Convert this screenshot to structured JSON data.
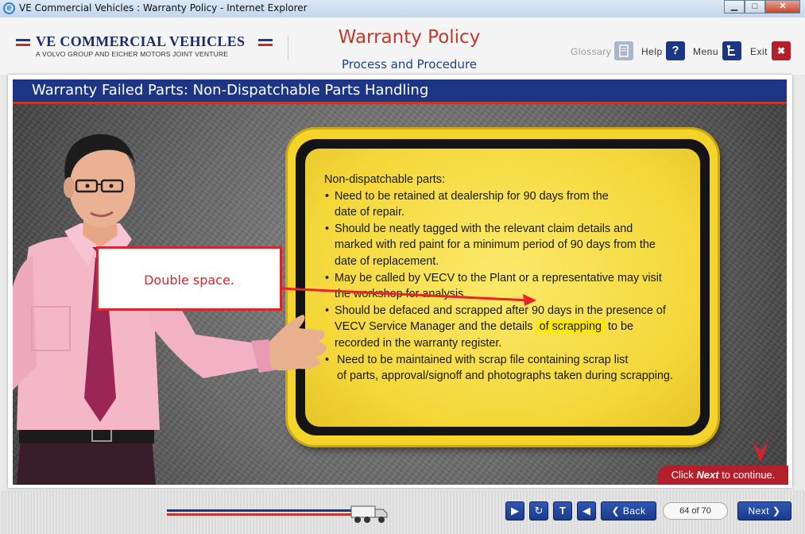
{
  "window": {
    "title": "VE Commercial Vehicles : Warranty Policy - Internet Explorer"
  },
  "logo": {
    "title": "VE COMMERCIAL VEHICLES",
    "subtitle": "A VOLVO GROUP AND EICHER MOTORS JOINT VENTURE"
  },
  "course": {
    "title": "Warranty Policy",
    "subtitle": "Process and Procedure"
  },
  "header_nav": {
    "glossary": "Glossary",
    "help": "Help",
    "menu": "Menu",
    "exit": "Exit"
  },
  "page": {
    "title": "Warranty Failed Parts: Non-Dispatchable Parts Handling"
  },
  "sign": {
    "heading": "Non-dispatchable parts:",
    "bullets": {
      "b1_l1": "Need to be retained at dealership for 90 days from the",
      "b1_l2": "date of repair.",
      "b2_l1": "Should be neatly tagged with the relevant claim  details and",
      "b2_l2": "marked with red paint for a minimum period of 90 days from the",
      "b2_l3": "date of replacement.",
      "b3_l1": "May be called by VECV to the Plant or a representative may visit",
      "b3_l2": "the workshop for analysis.",
      "b4_l1": "Should be defaced and scrapped after 90 days in the presence of",
      "b4_l2a": "VECV Service Manager and the details",
      "b4_l2_highlight": "of  scrapping",
      "b4_l2b": "to be",
      "b4_l3": "recorded in the warranty register.",
      "b5_l1": "Need to be maintained with scrap file containing scrap list",
      "b5_l2": "of parts, approval/signoff and photographs taken during scrapping."
    }
  },
  "callout": {
    "text": "Double space."
  },
  "prompt": {
    "pre": "Click ",
    "emph": "Next",
    "post": " to continue."
  },
  "footer": {
    "page_indicator": "64 of 70",
    "back_label": "Back",
    "next_label": "Next",
    "progress_fraction": 0.91
  },
  "colors": {
    "brand_blue": "#1c3585",
    "brand_red": "#c0392b",
    "sign_yellow": "#f5d42a"
  }
}
